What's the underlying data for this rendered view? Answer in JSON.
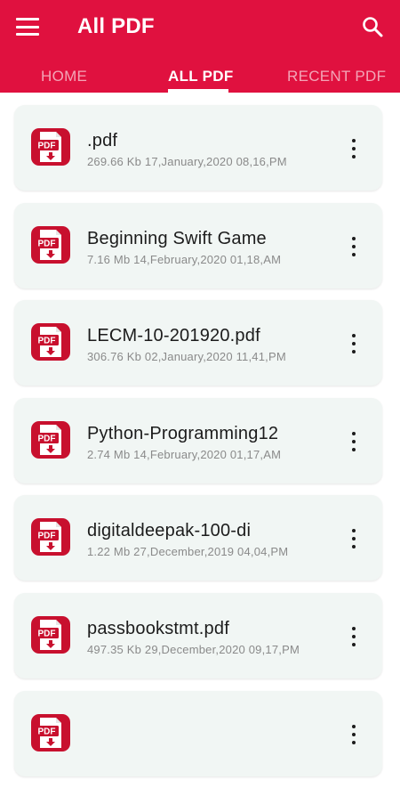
{
  "header": {
    "title": "All PDF",
    "background_color": "#e0113f",
    "menu_icon": "hamburger-menu-icon",
    "search_icon": "search-icon"
  },
  "tabs": [
    {
      "label": "HOME",
      "active": false
    },
    {
      "label": "ALL PDF",
      "active": true
    },
    {
      "label": "RECENT PDF",
      "active": false
    }
  ],
  "files": [
    {
      "name": ".pdf",
      "meta": "269.66 Kb 17,January,2020 08,16,PM"
    },
    {
      "name": "Beginning Swift Game",
      "meta": "7.16 Mb 14,February,2020 01,18,AM"
    },
    {
      "name": "LECM-10-201920.pdf",
      "meta": "306.76 Kb 02,January,2020 11,41,PM"
    },
    {
      "name": "Python-Programming12",
      "meta": "2.74 Mb 14,February,2020 01,17,AM"
    },
    {
      "name": "digitaldeepak-100-di",
      "meta": "1.22 Mb 27,December,2019 04,04,PM"
    },
    {
      "name": "passbookstmt.pdf",
      "meta": "497.35 Kb 29,December,2020 09,17,PM"
    },
    {
      "name": "",
      "meta": ""
    }
  ],
  "file_icon": {
    "name": "pdf-file-icon",
    "label": "PDF",
    "color": "#c8102e"
  },
  "more_icon": "more-vertical-icon"
}
